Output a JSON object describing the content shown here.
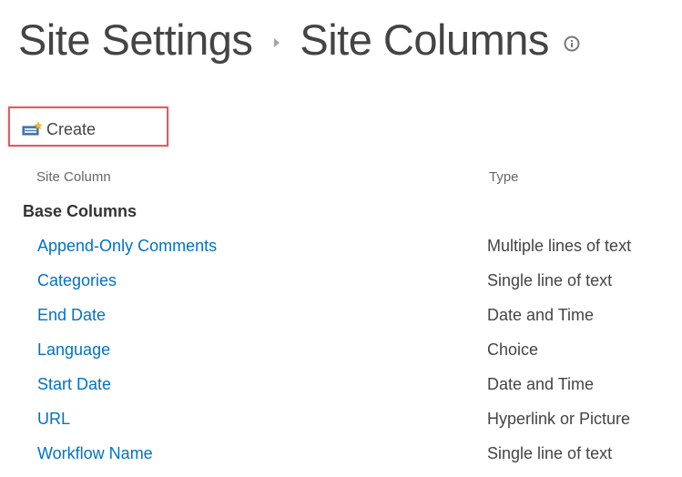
{
  "breadcrumb": {
    "parent": "Site Settings",
    "current": "Site Columns"
  },
  "toolbar": {
    "create_label": "Create",
    "create_icon": "new-column-icon"
  },
  "table": {
    "headers": {
      "name": "Site Column",
      "type": "Type"
    },
    "group": "Base Columns",
    "rows": [
      {
        "name": "Append-Only Comments",
        "type": "Multiple lines of text"
      },
      {
        "name": "Categories",
        "type": "Single line of text"
      },
      {
        "name": "End Date",
        "type": "Date and Time"
      },
      {
        "name": "Language",
        "type": "Choice"
      },
      {
        "name": "Start Date",
        "type": "Date and Time"
      },
      {
        "name": "URL",
        "type": "Hyperlink or Picture"
      },
      {
        "name": "Workflow Name",
        "type": "Single line of text"
      }
    ]
  },
  "colors": {
    "link": "#0072c6",
    "highlight_border": "#e35a5f",
    "text": "#444444"
  }
}
